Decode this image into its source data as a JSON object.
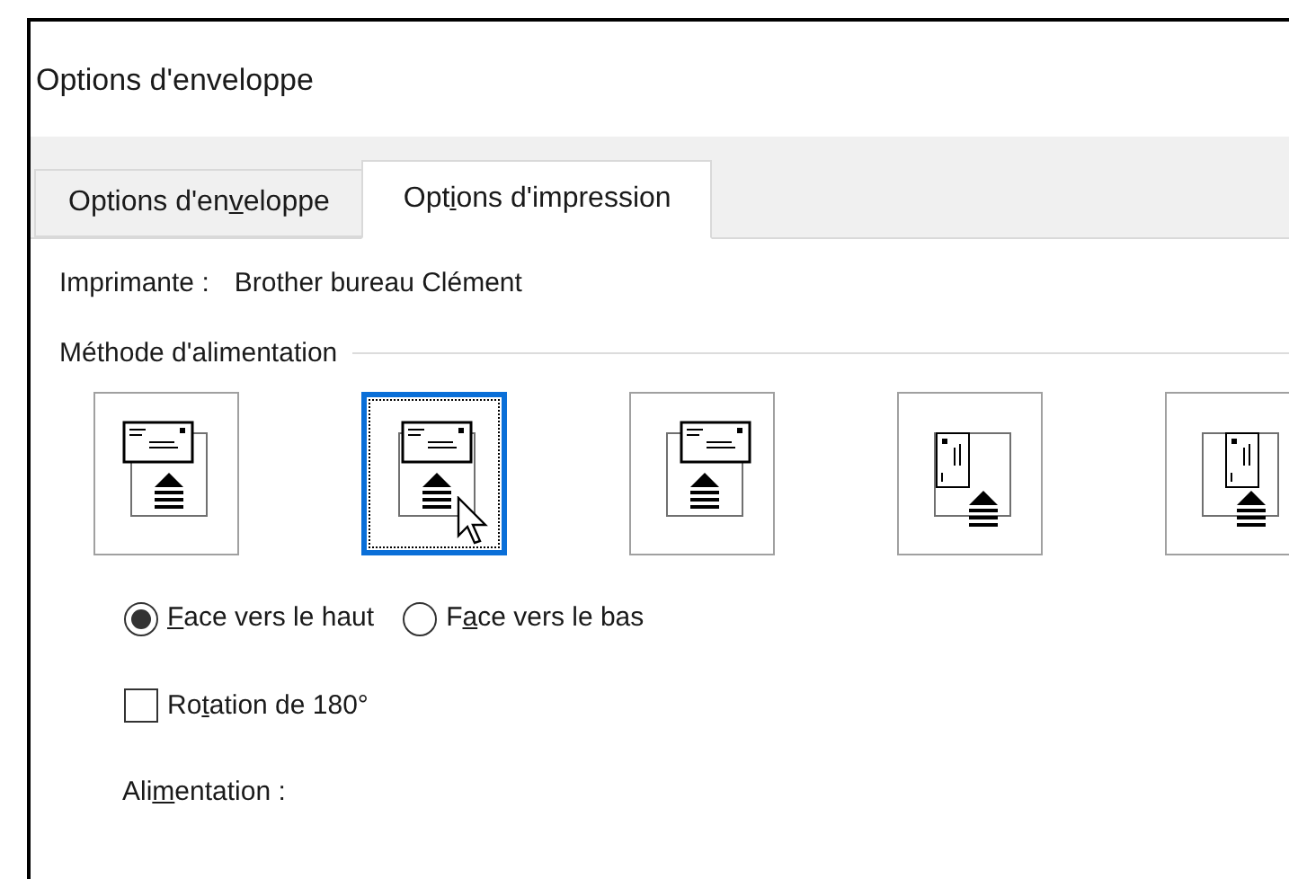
{
  "window": {
    "title": "Options d'enveloppe"
  },
  "tabs": [
    {
      "label": {
        "before": "Options d'en",
        "key": "v",
        "after": "eloppe"
      },
      "selected": false
    },
    {
      "label": {
        "before": "Opt",
        "key": "i",
        "after": "ons d'impression"
      },
      "selected": true
    }
  ],
  "printer": {
    "label": "Imprimante :",
    "value": "Brother bureau Clément"
  },
  "feed_method": {
    "title": "Méthode d'alimentation",
    "options": [
      {
        "kind": "landscape-left",
        "selected": false
      },
      {
        "kind": "landscape-center",
        "selected": true
      },
      {
        "kind": "landscape-right",
        "selected": false
      },
      {
        "kind": "portrait-left",
        "selected": false
      },
      {
        "kind": "portrait-center",
        "selected": false
      }
    ]
  },
  "orientation": [
    {
      "label": {
        "key": "F",
        "after": "ace vers le haut"
      },
      "selected": true
    },
    {
      "label": {
        "before": "F",
        "key": "a",
        "after": "ce vers le bas"
      },
      "selected": false
    }
  ],
  "rotation": {
    "label": {
      "before": "Ro",
      "key": "t",
      "after": "ation de 180°"
    },
    "checked": false
  },
  "feed": {
    "label": {
      "before": "Ali",
      "key": "m",
      "after": "entation :"
    }
  }
}
